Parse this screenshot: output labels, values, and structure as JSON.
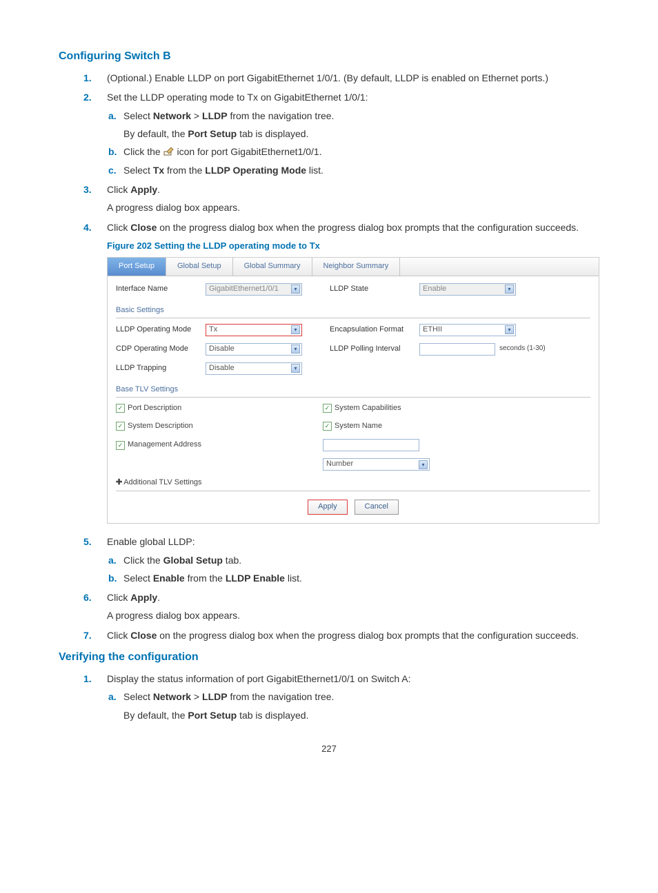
{
  "sectionA": {
    "title": "Configuring Switch B",
    "step1": "(Optional.) Enable LLDP on port GigabitEthernet 1/0/1. (By default, LLDP is enabled on Ethernet ports.)",
    "step2": "Set the LLDP operating mode to Tx on GigabitEthernet 1/0/1:",
    "step2a_pre": "Select ",
    "step2a_b1": "Network",
    "step2a_mid": " > ",
    "step2a_b2": "LLDP",
    "step2a_post": " from the navigation tree.",
    "step2a_note_pre": "By default, the ",
    "step2a_note_b": "Port Setup",
    "step2a_note_post": " tab is displayed.",
    "step2b_pre": "Click the ",
    "step2b_post": " icon for port GigabitEthernet1/0/1.",
    "step2c_pre": "Select ",
    "step2c_b1": "Tx",
    "step2c_mid": " from the ",
    "step2c_b2": "LLDP Operating Mode",
    "step2c_post": " list.",
    "step3_pre": "Click ",
    "step3_b": "Apply",
    "step3_post": ".",
    "step3_note": "A progress dialog box appears.",
    "step4_pre": "Click ",
    "step4_b": "Close",
    "step4_post": " on the progress dialog box when the progress dialog box prompts that the configuration succeeds.",
    "fig_caption": "Figure 202 Setting the LLDP operating mode to Tx",
    "step5": "Enable global LLDP:",
    "step5a_pre": "Click the ",
    "step5a_b": "Global Setup",
    "step5a_post": " tab.",
    "step5b_pre": "Select ",
    "step5b_b1": "Enable",
    "step5b_mid": " from the ",
    "step5b_b2": "LLDP Enable",
    "step5b_post": " list.",
    "step6_pre": "Click ",
    "step6_b": "Apply",
    "step6_post": ".",
    "step6_note": "A progress dialog box appears.",
    "step7_pre": "Click ",
    "step7_b": "Close",
    "step7_post": " on the progress dialog box when the progress dialog box prompts that the configuration succeeds."
  },
  "screenshot": {
    "tabs": {
      "port_setup": "Port Setup",
      "global_setup": "Global Setup",
      "global_summary": "Global Summary",
      "neighbor_summary": "Neighbor Summary"
    },
    "interface_name_lbl": "Interface Name",
    "interface_name_val": "GigabitEthernet1/0/1",
    "lldp_state_lbl": "LLDP State",
    "lldp_state_val": "Enable",
    "basic_settings": "Basic Settings",
    "lldp_op_mode_lbl": "LLDP Operating Mode",
    "lldp_op_mode_val": "Tx",
    "encap_lbl": "Encapsulation Format",
    "encap_val": "ETHII",
    "cdp_lbl": "CDP Operating Mode",
    "cdp_val": "Disable",
    "poll_lbl": "LLDP Polling Interval",
    "poll_unit": "seconds (1-30)",
    "trap_lbl": "LLDP Trapping",
    "trap_val": "Disable",
    "base_tlv": "Base TLV Settings",
    "cb_port_desc": "Port Description",
    "cb_sys_cap": "System Capabilities",
    "cb_sys_desc": "System Description",
    "cb_sys_name": "System Name",
    "cb_mgmt_addr": "Management Address",
    "number_val": "Number",
    "additional_tlv": "Additional TLV Settings",
    "apply": "Apply",
    "cancel": "Cancel"
  },
  "sectionB": {
    "title": "Verifying the configuration",
    "step1": "Display the status information of port GigabitEthernet1/0/1 on Switch A:",
    "step1a_pre": "Select ",
    "step1a_b1": "Network",
    "step1a_mid": " > ",
    "step1a_b2": "LLDP",
    "step1a_post": " from the navigation tree.",
    "step1a_note_pre": "By default, the ",
    "step1a_note_b": "Port Setup",
    "step1a_note_post": " tab is displayed."
  },
  "pagenum": "227"
}
